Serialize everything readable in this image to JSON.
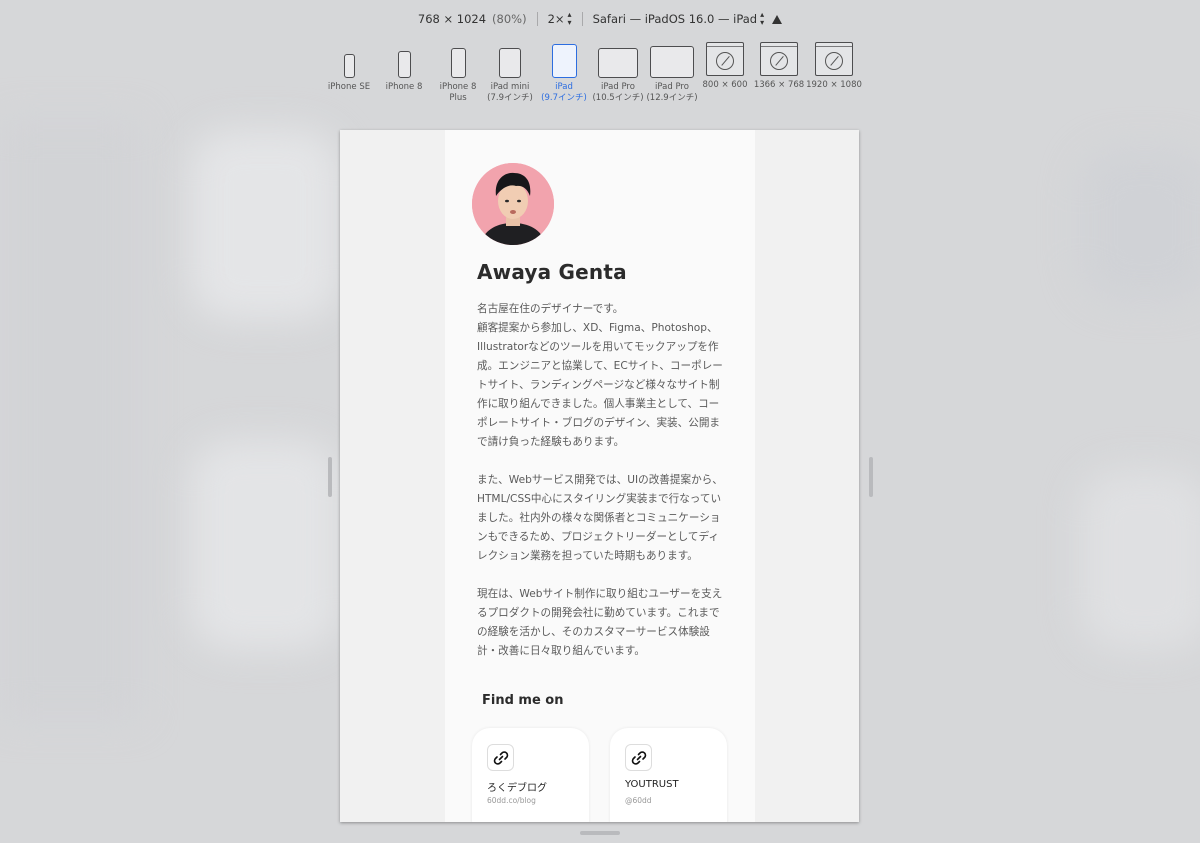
{
  "toolbar": {
    "resolution": "768 × 1024",
    "zoom": "(80%)",
    "scale": "2×",
    "browser": "Safari — iPadOS 16.0 — iPad"
  },
  "devices": [
    {
      "label": "iPhone SE",
      "label2": "",
      "kind": "phone-s",
      "active": false
    },
    {
      "label": "iPhone 8",
      "label2": "",
      "kind": "phone-m",
      "active": false
    },
    {
      "label": "iPhone 8",
      "label2": "Plus",
      "kind": "phone-l",
      "active": false
    },
    {
      "label": "iPad mini",
      "label2": "(7.9インチ)",
      "kind": "tablet-s",
      "active": false
    },
    {
      "label": "iPad",
      "label2": "(9.7インチ)",
      "kind": "tablet-active",
      "active": true
    },
    {
      "label": "iPad Pro",
      "label2": "(10.5インチ)",
      "kind": "tablet-land",
      "active": false
    },
    {
      "label": "iPad Pro",
      "label2": "(12.9インチ)",
      "kind": "tablet-land-l",
      "active": false
    },
    {
      "label": "800 × 600",
      "label2": "",
      "kind": "desktop",
      "active": false
    },
    {
      "label": "1366 × 768",
      "label2": "",
      "kind": "desktop",
      "active": false
    },
    {
      "label": "1920 × 1080",
      "label2": "",
      "kind": "desktop",
      "active": false
    }
  ],
  "profile": {
    "name": "Awaya Genta",
    "bio": [
      "名古屋在住のデザイナーです。\n顧客提案から参加し、XD、Figma、Photoshop、Illustratorなどのツールを用いてモックアップを作成。エンジニアと協業して、ECサイト、コーポレートサイト、ランディングページなど様々なサイト制作に取り組んできました。個人事業主として、コーポレートサイト・ブログのデザイン、実装、公開まで請け負った経験もあります。",
      "また、Webサービス開発では、UIの改善提案から、HTML/CSS中心にスタイリング実装まで行なっていました。社内外の様々な関係者とコミュニケーションもできるため、プロジェクトリーダーとしてディレクション業務を担っていた時期もあります。",
      "現在は、Webサイト制作に取り組むユーザーを支えるプロダクトの開発会社に勤めています。これまでの経験を活かし、そのカスタマーサービス体験設計・改善に日々取り組んでいます。"
    ],
    "find_heading": "Find me on",
    "links": [
      {
        "title": "ろくデブログ",
        "sub": "60dd.co/blog",
        "icon": "link-icon"
      },
      {
        "title": "YOUTRUST",
        "sub": "@60dd",
        "icon": "link-icon"
      }
    ]
  },
  "colors": {
    "accent": "#2c6de0",
    "avatar_bg": "#f2a3ad"
  }
}
